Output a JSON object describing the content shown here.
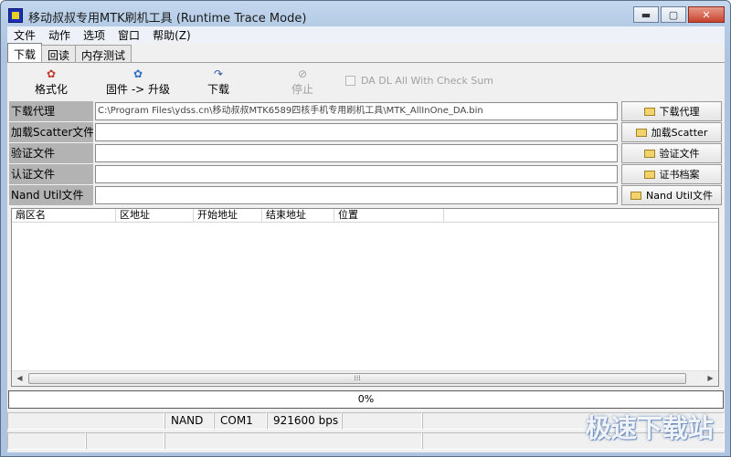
{
  "window": {
    "title": "移动叔叔专用MTK刷机工具 (Runtime Trace Mode)",
    "controls": {
      "minimize": "▬",
      "maximize": "▢",
      "close": "✕"
    }
  },
  "menu": [
    "文件",
    "动作",
    "选项",
    "窗口",
    "帮助(Z)"
  ],
  "tabs": [
    "下载",
    "回读",
    "内存测试"
  ],
  "active_tab": "下载",
  "toolbar": {
    "format": {
      "label": "格式化",
      "icon": "✿"
    },
    "firmware_upgrade": {
      "label": "固件 -> 升级",
      "icon": "✿"
    },
    "download": {
      "label": "下载",
      "icon": "↷"
    },
    "stop": {
      "label": "停止",
      "icon": "⊘"
    },
    "checksum": {
      "label": "DA DL All With Check Sum",
      "checked": false
    }
  },
  "fields": [
    {
      "label": "下载代理",
      "value": "C:\\Program Files\\ydss.cn\\移动叔叔MTK6589四核手机专用刷机工具\\MTK_AllInOne_DA.bin",
      "button": "下载代理"
    },
    {
      "label": "加载Scatter文件",
      "value": "",
      "button": "加载Scatter"
    },
    {
      "label": "验证文件",
      "value": "",
      "button": "验证文件"
    },
    {
      "label": "认证文件",
      "value": "",
      "button": "证书档案"
    },
    {
      "label": "Nand Util文件",
      "value": "",
      "button": "Nand Util文件"
    }
  ],
  "table": {
    "columns": [
      "扇区名",
      "区地址",
      "开始地址",
      "结束地址",
      "位置"
    ],
    "rows": []
  },
  "scrollbar": {
    "left": "◀",
    "right": "▶",
    "grip": "⁞⁞⁞"
  },
  "progress": {
    "text": "0%",
    "value": 0
  },
  "status": {
    "storage": "NAND",
    "port": "COM1",
    "baud": "921600 bps"
  },
  "watermark": "极速下载站",
  "colors": {
    "title_gradient": "#b4cbe5",
    "label_bg": "#b3b3b3",
    "close_btn": "#c7432e"
  }
}
